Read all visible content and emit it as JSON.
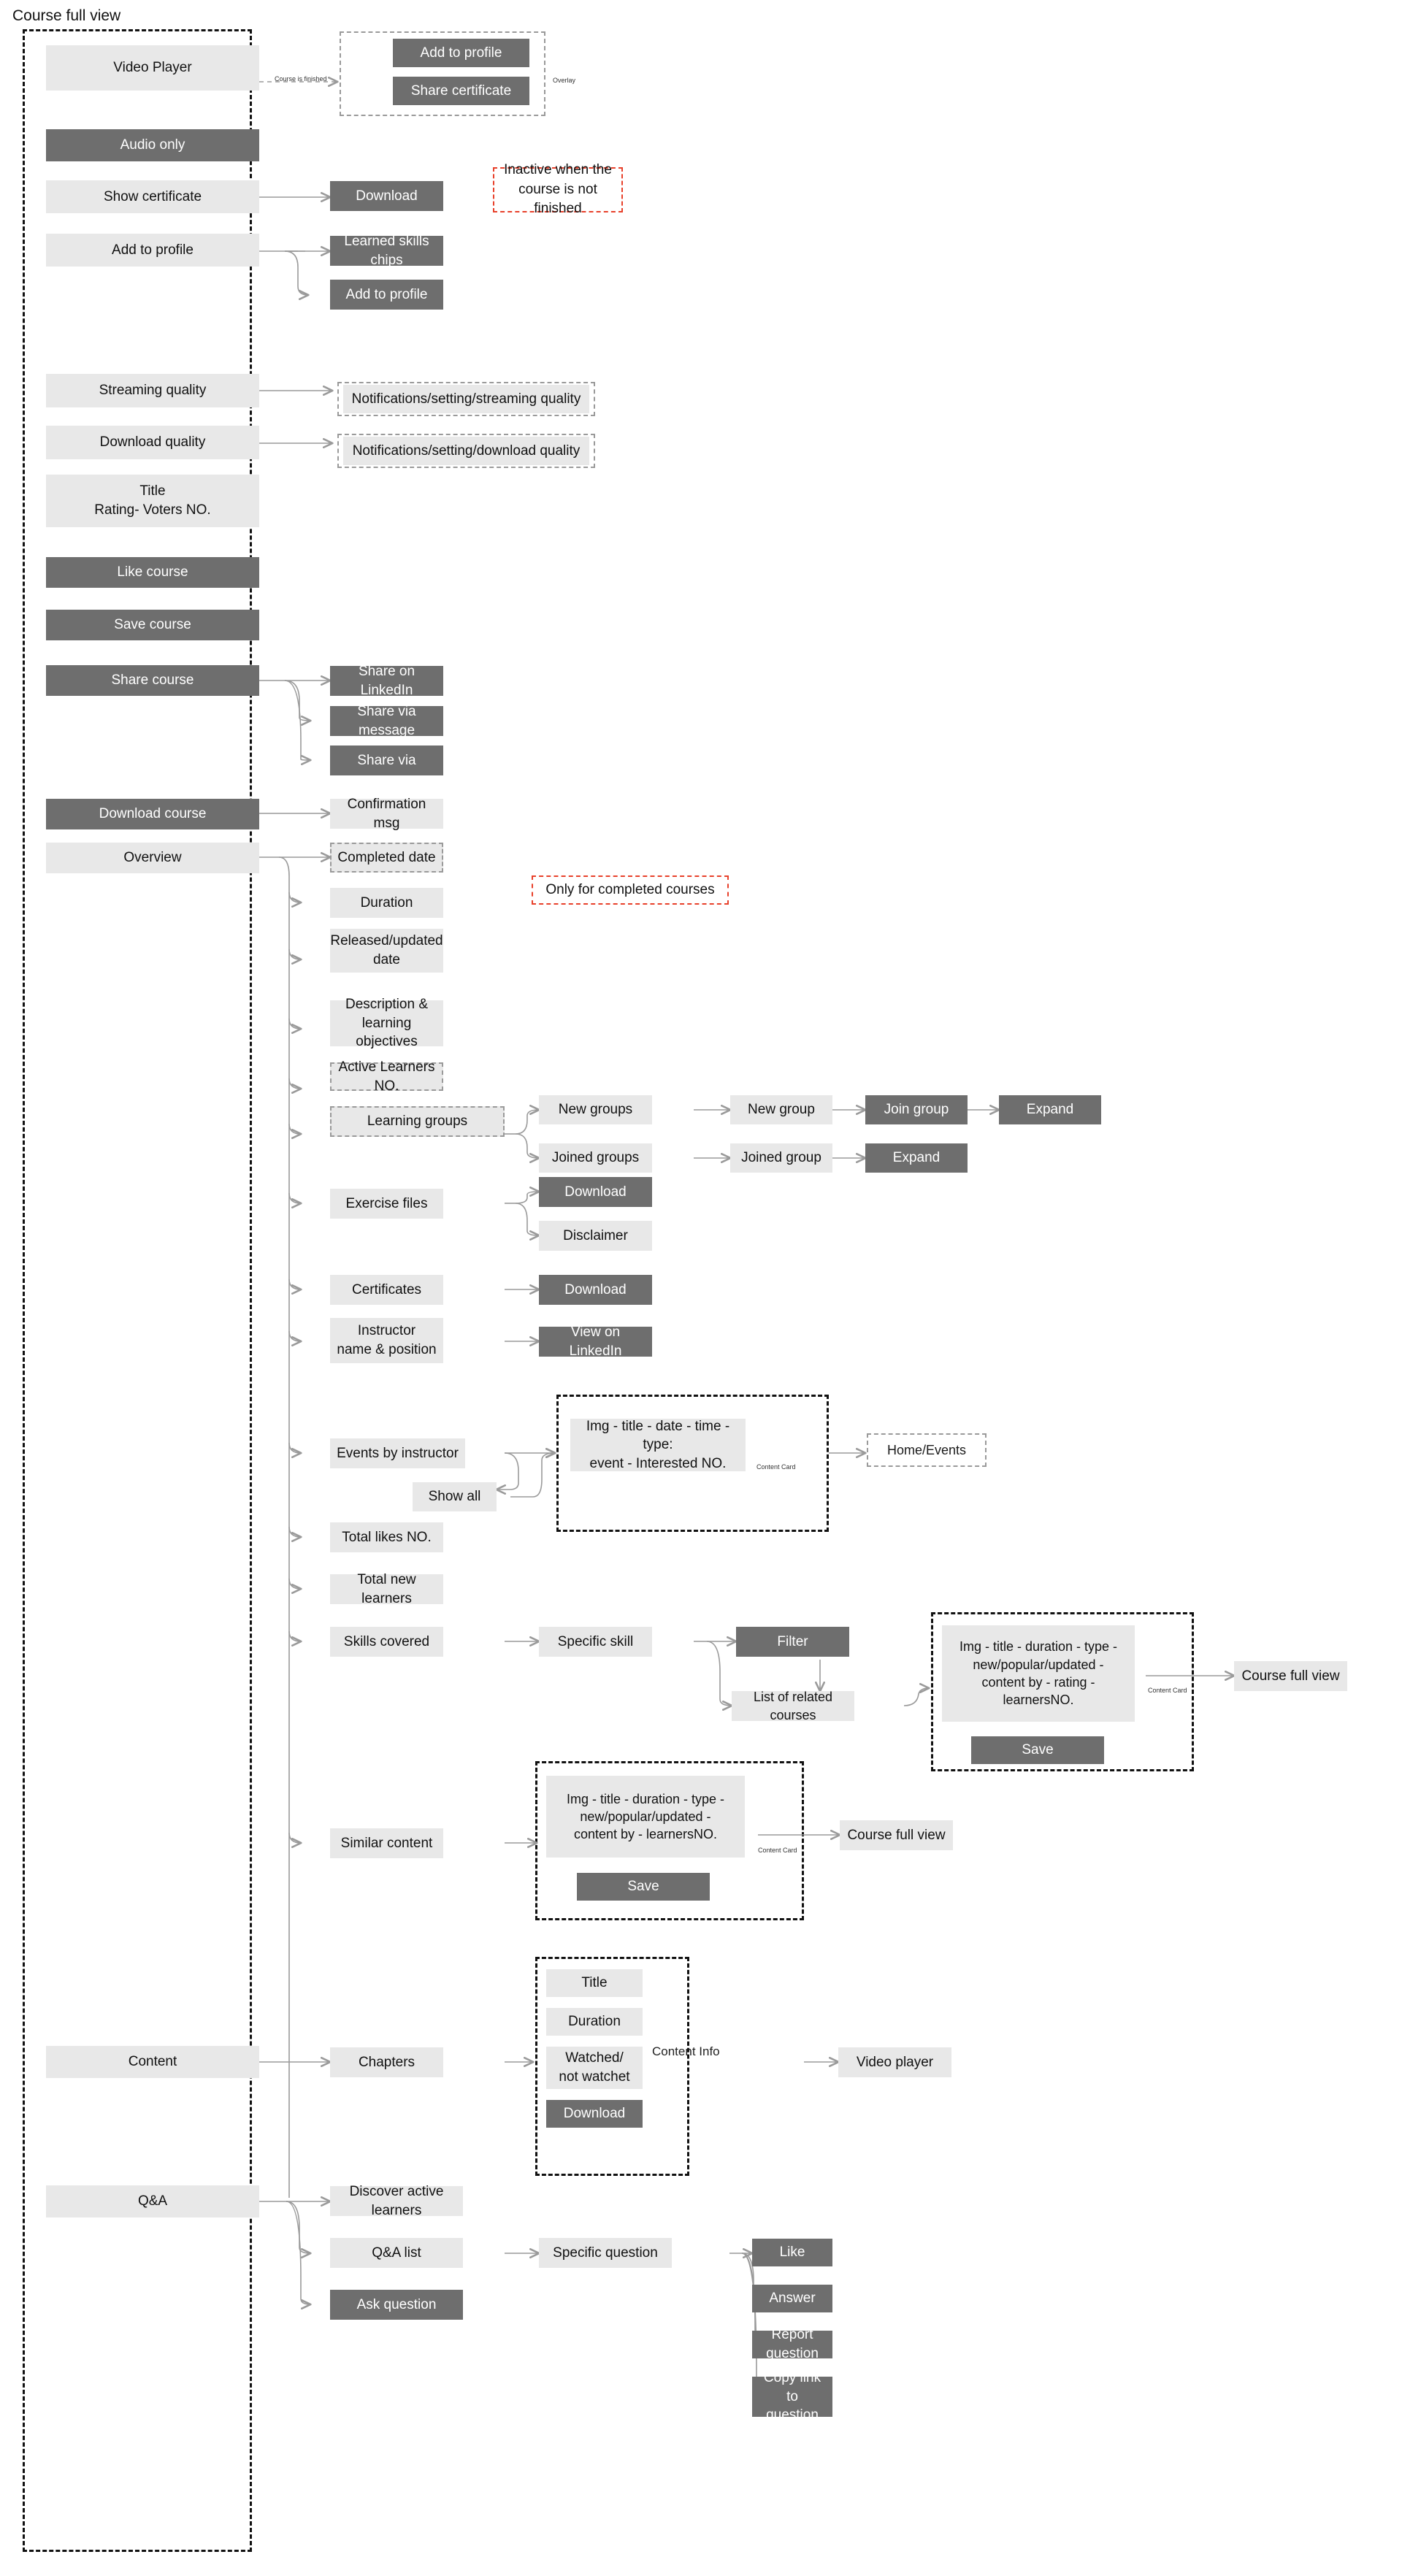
{
  "page": {
    "title": "Course full view"
  },
  "nodes": {
    "video_player": "Video Player",
    "audio_only": "Audio only",
    "show_certificate": "Show certificate",
    "add_to_profile_main": "Add to profile",
    "streaming_quality": "Streaming quality",
    "download_quality": "Download quality",
    "title_rating": "Title\nRating- Voters NO.",
    "like_course": "Like course",
    "save_course": "Save course",
    "share_course": "Share course",
    "download_course": "Download course",
    "overview": "Overview",
    "content": "Content",
    "qa": "Q&A",
    "overlay_add_to_profile": "Add to profile",
    "overlay_share_certificate": "Share certificate",
    "overlay_label": "Overlay",
    "edge_course_is_finished": "Course is finished",
    "download_cert": "Download",
    "learned_skills_chips": "Learned skills chips",
    "add_to_profile_child": "Add to profile",
    "notif_streaming": "Notifications/setting/streaming quality",
    "notif_download": "Notifications/setting/download quality",
    "share_on_linkedin": "Share on LinkedIn",
    "share_via_message": "Share via message",
    "share_via": "Share via",
    "confirmation_msg": "Confirmation msg",
    "completed_date": "Completed date",
    "duration": "Duration",
    "released_updated_date": "Released/updated date",
    "description_objectives": "Description &\nlearning objectives",
    "active_learners_no": "Active Learners NO.",
    "learning_groups": "Learning groups",
    "new_groups": "New groups",
    "joined_groups": "Joined groups",
    "new_group": "New group",
    "joined_group": "Joined group",
    "join_group": "Join group",
    "expand_1": "Expand",
    "expand_2": "Expand",
    "exercise_files": "Exercise files",
    "download_exercise": "Download",
    "disclaimer": "Disclaimer",
    "certificates": "Certificates",
    "download_certificates": "Download",
    "instructor": "Instructor\nname & position",
    "view_on_linkedin": "View on LinkedIn",
    "events_by_instructor": "Events by instructor",
    "show_all": "Show all",
    "event_card": "Img - title - date - time - type:\nevent - Interested NO.",
    "home_events": "Home/Events",
    "total_likes_no": "Total likes NO.",
    "total_new_learners": "Total new learners",
    "skills_covered": "Skills covered",
    "specific_skill": "Specific skill",
    "filter": "Filter",
    "list_of_related_courses": "List of related courses",
    "course_card_big": "Img - title - duration - type -\nnew/popular/updated -\ncontent by - rating -\nlearnersNO.",
    "save_card_big": "Save",
    "course_full_view_right": "Course full view",
    "similar_content": "Similar content",
    "course_card_small": "Img - title - duration - type -\nnew/popular/updated -\ncontent by - learnersNO.",
    "save_card_small": "Save",
    "course_full_view_similar": "Course full view",
    "chapters": "Chapters",
    "chapter_title": "Title",
    "chapter_duration": "Duration",
    "chapter_watched": "Watched/\nnot watchet",
    "chapter_download": "Download",
    "content_info_label": "Content\nInfo",
    "video_player_right": "Video player",
    "discover_active_learners": "Discover active learners",
    "qa_list": "Q&A list",
    "ask_question": "Ask question",
    "specific_question": "Specific question",
    "like": "Like",
    "answer": "Answer",
    "report_question": "Report question",
    "copy_link_to_question": "Copy link to\nquestion",
    "content_card_label_1": "Content Card",
    "content_card_label_2": "Content Card",
    "content_card_label_3": "Content Card"
  },
  "notes": {
    "inactive_note": "Inactive when the\ncourse is not finished",
    "completed_note": "Only for completed courses"
  },
  "colors": {
    "light_fill": "#e8e8e8",
    "dark_fill": "#6e6e6e",
    "note_border": "#e8402a",
    "wire": "#9a9a9a",
    "frame_black": "#111111",
    "frame_gray": "#9a9a9a"
  }
}
